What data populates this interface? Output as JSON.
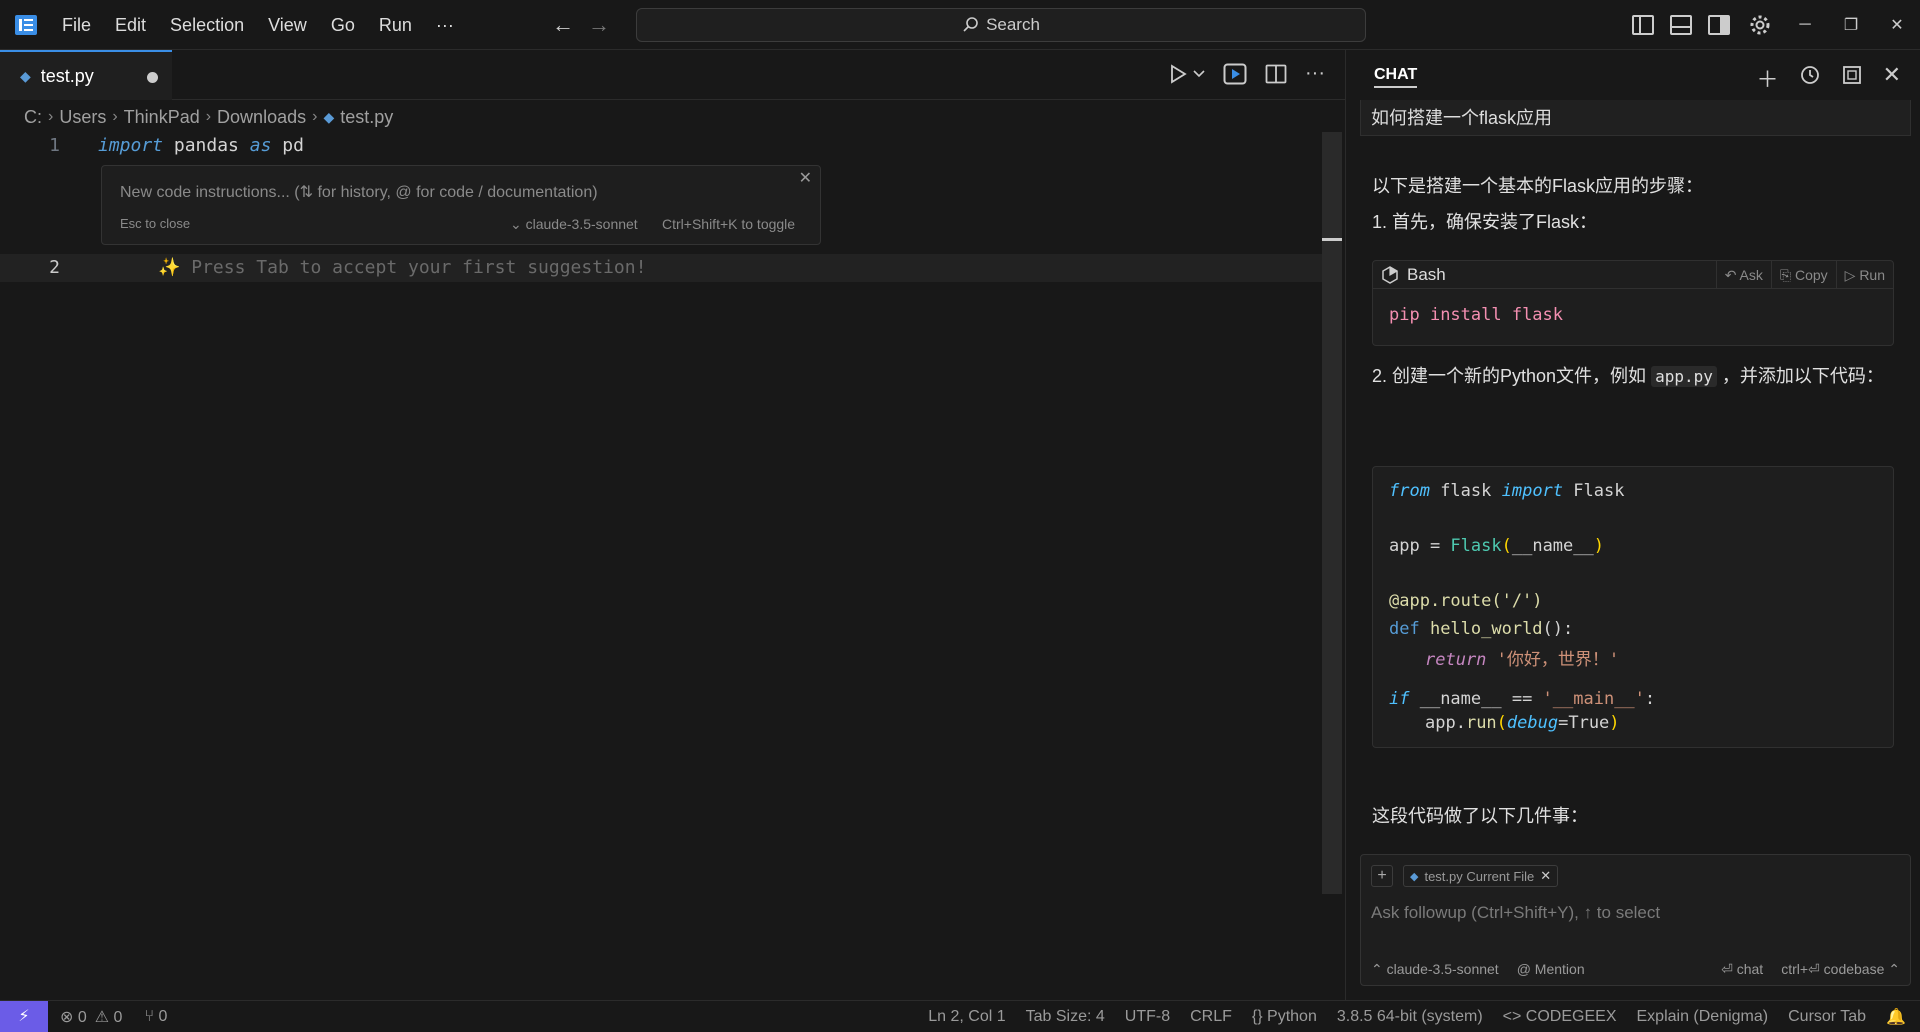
{
  "titlebar": {
    "menu": [
      "File",
      "Edit",
      "Selection",
      "View",
      "Go",
      "Run",
      "···"
    ],
    "search_placeholder": "Search",
    "back_icon": "←",
    "forward_icon": "→",
    "window": {
      "minimize": "─",
      "restore": "❐",
      "close": "✕"
    }
  },
  "tabs": [
    {
      "label": "test.py",
      "dirty": true
    }
  ],
  "breadcrumb": [
    "C:",
    "Users",
    "ThinkPad",
    "Downloads",
    "test.py"
  ],
  "editor": {
    "lines": [
      {
        "number": "1",
        "kw1": "import",
        "id1": " pandas ",
        "kw2": "as",
        "id2": " pd"
      },
      {
        "number": "2",
        "ghost": "✨ Press Tab to accept your first suggestion!"
      }
    ],
    "inline_prompt": {
      "placeholder": "New code instructions... (⇅ for history, @ for code / documentation)",
      "esc": "Esc to close",
      "model": "⌄ claude-3.5-sonnet",
      "toggle": "Ctrl+Shift+K to toggle"
    }
  },
  "chat": {
    "title": "CHAT",
    "user_message": "如何搭建一个flask应用",
    "intro": "以下是搭建一个基本的Flask应用的步骤：",
    "step1": "1. 首先，确保安装了Flask：",
    "bash_block": {
      "lang": "Bash",
      "actions": [
        "↶ Ask",
        "⎘ Copy",
        "▷ Run"
      ],
      "cmd": "pip",
      "args": " install flask"
    },
    "step2_pre": "2. 创建一个新的Python文件，例如 ",
    "step2_code": "app.py",
    "step2_post": " ，并添加以下代码：",
    "python_block": {
      "l1_from": "from",
      "l1_mid": " flask ",
      "l1_import": "import",
      "l1_end": " Flask",
      "l3_a": "app = ",
      "l3_b": "Flask",
      "l3_c": "(",
      "l3_d": "__name__",
      "l3_e": ")",
      "l5": "@app.route('/')",
      "l6_def": "def",
      "l6_fn": " hello_world",
      "l6_end": "():",
      "l7_ret": "return",
      "l7_str": " '你好，世界！'",
      "l9_if": "if",
      "l9_mid": " __name__ == ",
      "l9_str": "'__main__'",
      "l9_end": ":",
      "l10_a": "app.",
      "l10_fn": "run",
      "l10_b": "(",
      "l10_kw": "debug",
      "l10_c": "=True",
      "l10_d": ")"
    },
    "outro": "这段代码做了以下几件事：",
    "input": {
      "chip": "test.py  Current File",
      "placeholder": "Ask followup (Ctrl+Shift+Y), ↑ to select",
      "model": "⌃ claude-3.5-sonnet",
      "mention": "@ Mention",
      "chat": "⏎ chat",
      "codebase": "ctrl+⏎ codebase ⌃"
    }
  },
  "statusbar": {
    "remote": "⚡",
    "errors": "⊗ 0",
    "warnings": "⚠ 0",
    "ports": "⑂ 0",
    "position": "Ln 2, Col 1",
    "tab_size": "Tab Size: 4",
    "encoding": "UTF-8",
    "eol": "CRLF",
    "language": "{} Python",
    "interpreter": "3.8.5 64-bit (system)",
    "codegeex": "<> CODEGEEX",
    "explain": "Explain (Denigma)",
    "cursor_tab": "Cursor Tab",
    "bell": "🔔"
  },
  "colors": {
    "accent": "#3a8ee6",
    "remote": "#6b5ce7"
  }
}
